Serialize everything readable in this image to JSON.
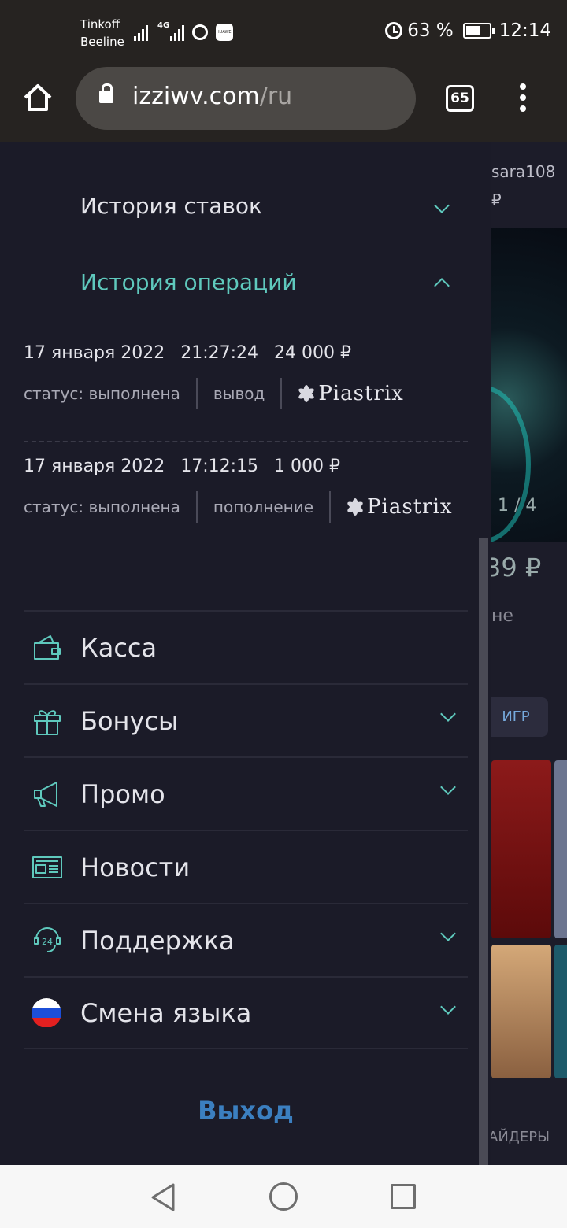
{
  "status_bar": {
    "carrier1": "Tinkoff",
    "carrier2": "Beeline",
    "network": "4G",
    "battery": "63 %",
    "battery_level": 0.63,
    "time": "12:14"
  },
  "browser": {
    "url_domain": "izziwv.com",
    "url_path": "/ru",
    "tab_count": "65"
  },
  "background": {
    "username": "sara108",
    "currency": "₽",
    "slide_counter": "1 / 4",
    "balance": "39 ₽",
    "row_text": "не",
    "button_text": "ИГР",
    "tab_label": "АЙДЕРЫ"
  },
  "drawer": {
    "bet_history": "История ставок",
    "op_history": "История операций",
    "operations": [
      {
        "date": "17 января 2022",
        "time": "21:27:24",
        "amount": "24 000 ₽",
        "status": "статус: выполнена",
        "type": "вывод",
        "provider": "Piastrix"
      },
      {
        "date": "17 января 2022",
        "time": "17:12:15",
        "amount": "1 000 ₽",
        "status": "статус: выполнена",
        "type": "пополнение",
        "provider": "Piastrix"
      }
    ],
    "menu": {
      "kassa": "Касса",
      "bonuses": "Бонусы",
      "promo": "Промо",
      "news": "Новости",
      "support": "Поддержка",
      "language": "Смена языка"
    },
    "logout": "Выход"
  },
  "colors": {
    "accent": "#5fc9bd",
    "logout": "#3b7fc0",
    "drawer_bg": "#1b1b28"
  }
}
